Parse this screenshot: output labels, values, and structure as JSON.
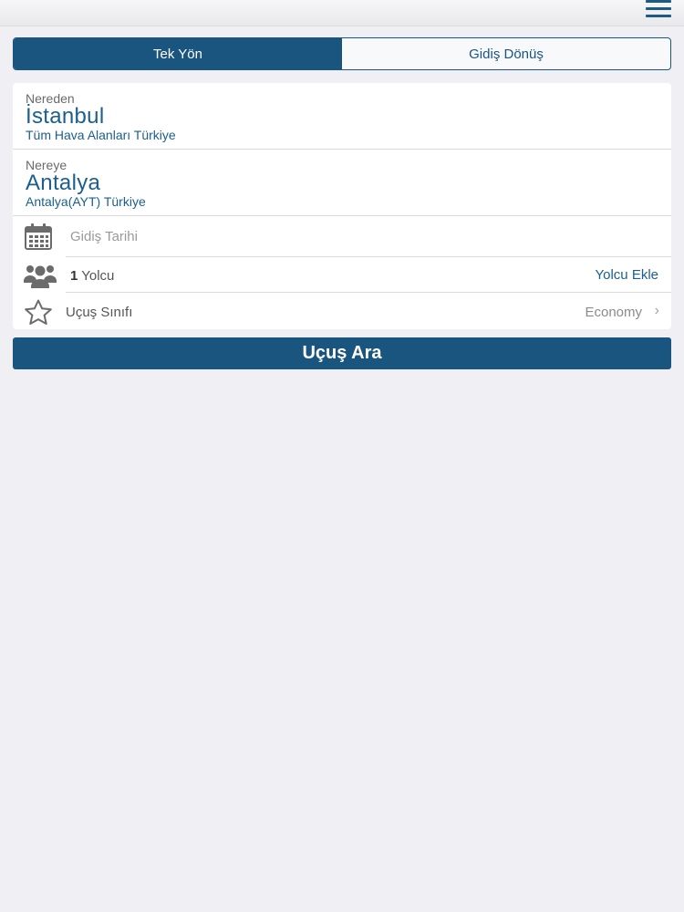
{
  "header": {
    "menu_icon": "hamburger-menu-icon"
  },
  "trip_type": {
    "tabs": [
      {
        "label": "Tek Yön",
        "active": true
      },
      {
        "label": "Gidiş Dönüş",
        "active": false
      }
    ]
  },
  "form": {
    "from": {
      "caption": "Nereden",
      "city": "İstanbul",
      "detail": "Tüm Hava Alanları Türkiye"
    },
    "to": {
      "caption": "Nereye",
      "city": "Antalya",
      "detail": "Antalya(AYT) Türkiye"
    },
    "date": {
      "icon": "calendar-icon",
      "placeholder": "Gidiş Tarihi"
    },
    "passengers": {
      "icon": "people-icon",
      "count": "1",
      "label": "Yolcu",
      "add_label": "Yolcu Ekle"
    },
    "cabin_class": {
      "icon": "star-icon",
      "label": "Uçuş Sınıfı",
      "value": "Economy",
      "chevron": "›"
    }
  },
  "search_button": {
    "label": "Uçuş Ara"
  },
  "colors": {
    "primary": "#1a5580",
    "link": "#1a5f8e",
    "background": "#f0f0f4"
  }
}
